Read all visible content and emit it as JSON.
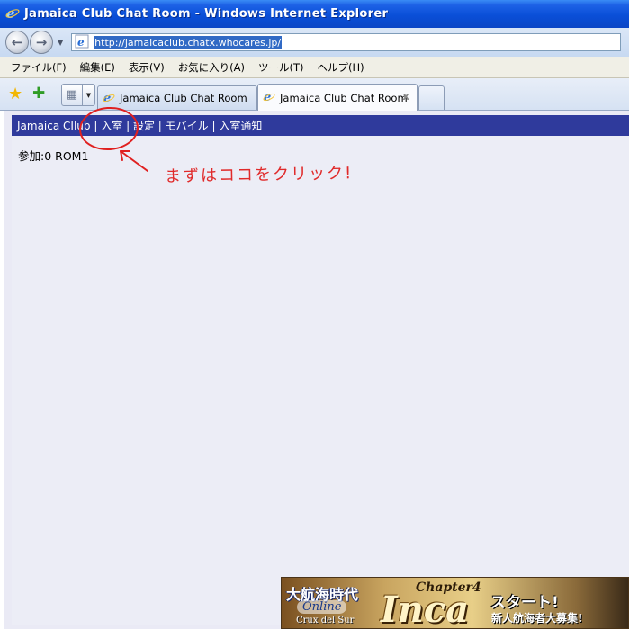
{
  "window": {
    "title": "Jamaica Club Chat Room - Windows Internet Explorer"
  },
  "address_bar": {
    "url": "http://jamaicaclub.chatx.whocares.jp/"
  },
  "menu": {
    "items": [
      "ファイル(F)",
      "編集(E)",
      "表示(V)",
      "お気に入り(A)",
      "ツール(T)",
      "ヘルプ(H)"
    ]
  },
  "tabs": [
    {
      "label": "Jamaica Club Chat Room",
      "active": false
    },
    {
      "label": "Jamaica Club Chat Room",
      "active": true,
      "close": "x"
    }
  ],
  "site_nav": {
    "items": [
      "Jamaica CIlub",
      "入室",
      "設定",
      "モバイル",
      "入室通知"
    ],
    "separator": "|"
  },
  "status": {
    "text": "参加:0 ROM1"
  },
  "annotation": {
    "text": "まずはココをクリック!",
    "color": "#e02020"
  },
  "banner": {
    "title": "大航海時代",
    "online": "Online",
    "subtitle": "Crux del Sur",
    "chapter": "Chapter4",
    "name": "Inca",
    "start": "スタート!",
    "recruit": "新人航海者大募集!"
  },
  "colors": {
    "site_nav_bg": "#2f3a9c",
    "page_bg": "#ecedf6",
    "titlebar": "#0a4fd8"
  }
}
